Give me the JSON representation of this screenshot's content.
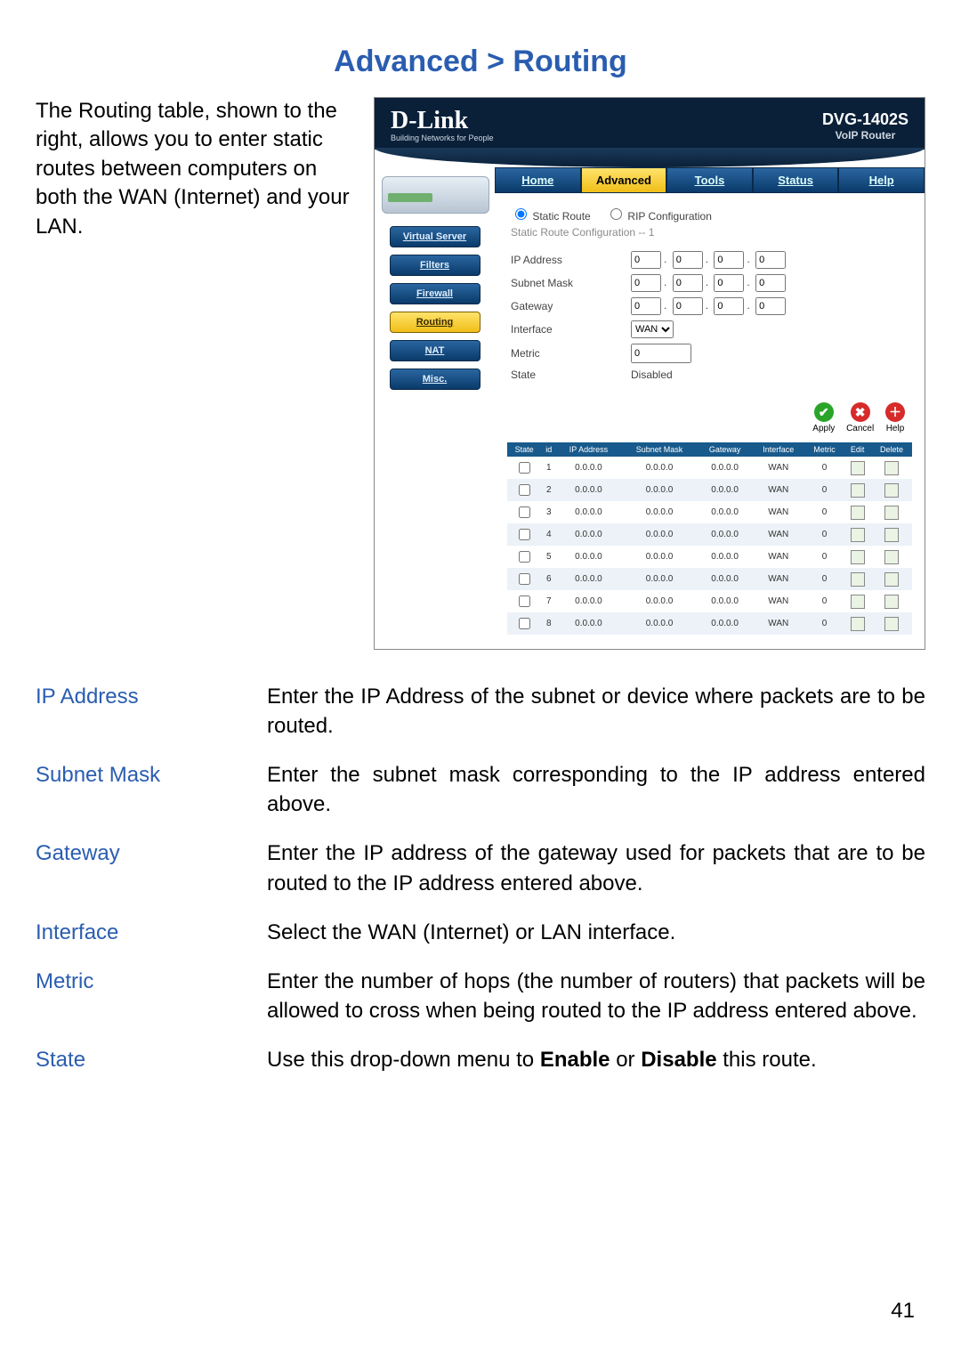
{
  "title": "Advanced > Routing",
  "intro": "The Routing table, shown to the right, allows you to enter static routes between computers on both the WAN (Internet) and your LAN.",
  "page_number": "41",
  "router_ui": {
    "brand": "D-Link",
    "brand_sub": "Building Networks for People",
    "model": "DVG-1402S",
    "model_sub": "VoIP Router",
    "tabs": [
      "Home",
      "Advanced",
      "Tools",
      "Status",
      "Help"
    ],
    "active_tab": "Advanced",
    "side_buttons": [
      "Virtual Server",
      "Filters",
      "Firewall",
      "Routing",
      "NAT",
      "Misc."
    ],
    "side_active": "Routing",
    "radio": {
      "static_route": "Static Route",
      "rip_config": "RIP Configuration"
    },
    "subheading": "Static Route Configuration -- 1",
    "form": {
      "ip_label": "IP Address",
      "subnet_label": "Subnet Mask",
      "gateway_label": "Gateway",
      "interface_label": "Interface",
      "interface_value": "WAN",
      "metric_label": "Metric",
      "metric_value": "0",
      "state_label": "State",
      "state_value": "Disabled",
      "ip_octets": {
        "ip": [
          "0",
          "0",
          "0",
          "0"
        ],
        "subnet": [
          "0",
          "0",
          "0",
          "0"
        ],
        "gateway": [
          "0",
          "0",
          "0",
          "0"
        ]
      }
    },
    "actions": {
      "apply": "Apply",
      "cancel": "Cancel",
      "help": "Help"
    },
    "table": {
      "headers": [
        "State",
        "id",
        "IP Address",
        "Subnet Mask",
        "Gateway",
        "Interface",
        "Metric",
        "Edit",
        "Delete"
      ],
      "rows": [
        {
          "id": "1",
          "ip": "0.0.0.0",
          "mask": "0.0.0.0",
          "gw": "0.0.0.0",
          "iface": "WAN",
          "metric": "0"
        },
        {
          "id": "2",
          "ip": "0.0.0.0",
          "mask": "0.0.0.0",
          "gw": "0.0.0.0",
          "iface": "WAN",
          "metric": "0"
        },
        {
          "id": "3",
          "ip": "0.0.0.0",
          "mask": "0.0.0.0",
          "gw": "0.0.0.0",
          "iface": "WAN",
          "metric": "0"
        },
        {
          "id": "4",
          "ip": "0.0.0.0",
          "mask": "0.0.0.0",
          "gw": "0.0.0.0",
          "iface": "WAN",
          "metric": "0"
        },
        {
          "id": "5",
          "ip": "0.0.0.0",
          "mask": "0.0.0.0",
          "gw": "0.0.0.0",
          "iface": "WAN",
          "metric": "0"
        },
        {
          "id": "6",
          "ip": "0.0.0.0",
          "mask": "0.0.0.0",
          "gw": "0.0.0.0",
          "iface": "WAN",
          "metric": "0"
        },
        {
          "id": "7",
          "ip": "0.0.0.0",
          "mask": "0.0.0.0",
          "gw": "0.0.0.0",
          "iface": "WAN",
          "metric": "0"
        },
        {
          "id": "8",
          "ip": "0.0.0.0",
          "mask": "0.0.0.0",
          "gw": "0.0.0.0",
          "iface": "WAN",
          "metric": "0"
        }
      ]
    }
  },
  "definitions": [
    {
      "term": "IP Address",
      "desc": "Enter the IP Address of the subnet or device where packets are to be routed."
    },
    {
      "term": "Subnet Mask",
      "desc": "Enter the subnet mask corresponding to the IP address entered above."
    },
    {
      "term": "Gateway",
      "desc": "Enter the IP address of the gateway used for packets that are to be routed to the IP address entered above."
    },
    {
      "term": "Interface",
      "desc": "Select the WAN (Internet) or LAN interface."
    },
    {
      "term": "Metric",
      "desc": "Enter the number of hops (the number of routers) that packets will be allowed to cross when being routed to the IP address entered above."
    },
    {
      "term": "State",
      "desc_pre": "Use this drop-down menu to ",
      "desc_mid": " or ",
      "desc_post": " this route.",
      "bold1": "Enable",
      "bold2": "Disable"
    }
  ]
}
